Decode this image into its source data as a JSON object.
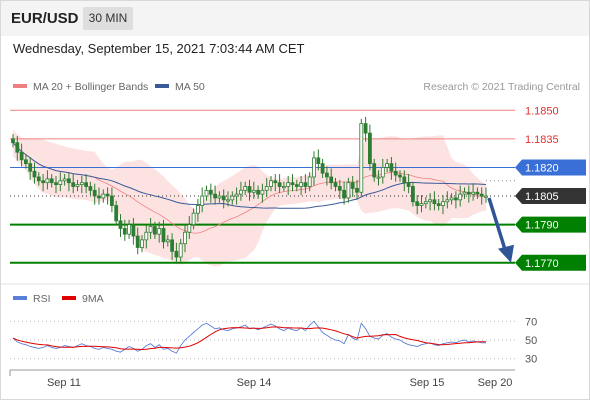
{
  "header": {
    "pair": "EUR/USD",
    "timeframe": "30 MIN",
    "datetime": "Wednesday, September 15, 2021 7:03:44 AM CET"
  },
  "legend": {
    "bollinger": "MA 20 + Bollinger Bands",
    "ma50": "MA 50",
    "rsi": "RSI",
    "ma9": "9MA"
  },
  "copyright": "Research © 2021 Trading Central",
  "colors": {
    "bollinger": "#f08080",
    "band_fill": "#fde2e2",
    "ma50": "#3a5a9a",
    "candle": "#2e7d32",
    "resistance": "#f08080",
    "pivot": "#3a6fd8",
    "current": "#333333",
    "support": "#008000",
    "arrow": "#2f5597",
    "rsi": "#5a7fd8",
    "rsi_ma": "#e00000"
  },
  "chart_data": {
    "type": "candlestick",
    "x_labels": [
      "Sep 11",
      "Sep 14",
      "Sep 15",
      "Sep 20"
    ],
    "y_range": [
      1.1762,
      1.1858
    ],
    "levels": [
      {
        "label": "1.1850",
        "value": 1.185,
        "kind": "resistance"
      },
      {
        "label": "1.1835",
        "value": 1.1835,
        "kind": "resistance"
      },
      {
        "label": "1.1820",
        "value": 1.182,
        "kind": "pivot"
      },
      {
        "label": "1.1805",
        "value": 1.1805,
        "kind": "current"
      },
      {
        "label": "1.1790",
        "value": 1.179,
        "kind": "support"
      },
      {
        "label": "1.1770",
        "value": 1.177,
        "kind": "support"
      }
    ],
    "close": [
      1.1833,
      1.1828,
      1.1824,
      1.1822,
      1.1818,
      1.1815,
      1.1813,
      1.1812,
      1.1814,
      1.1812,
      1.1811,
      1.1813,
      1.1814,
      1.1812,
      1.181,
      1.1811,
      1.1812,
      1.181,
      1.1808,
      1.1805,
      1.1804,
      1.1806,
      1.1805,
      1.18,
      1.1792,
      1.1788,
      1.1785,
      1.179,
      1.1784,
      1.1778,
      1.1782,
      1.1786,
      1.1789,
      1.1785,
      1.1788,
      1.1781,
      1.1782,
      1.1776,
      1.1773,
      1.178,
      1.1786,
      1.179,
      1.1796,
      1.18,
      1.1805,
      1.1808,
      1.1806,
      1.1804,
      1.1805,
      1.1803,
      1.1803,
      1.1805,
      1.1806,
      1.1808,
      1.181,
      1.1807,
      1.1808,
      1.1806,
      1.1808,
      1.181,
      1.1813,
      1.1812,
      1.181,
      1.181,
      1.1812,
      1.1811,
      1.181,
      1.1812,
      1.181,
      1.1815,
      1.1825,
      1.1822,
      1.1817,
      1.1815,
      1.1812,
      1.181,
      1.1808,
      1.1804,
      1.1812,
      1.1809,
      1.1807,
      1.1843,
      1.1838,
      1.1822,
      1.1815,
      1.1815,
      1.182,
      1.1822,
      1.1818,
      1.1816,
      1.1815,
      1.1812,
      1.181,
      1.1802,
      1.18,
      1.1801,
      1.1802,
      1.1803,
      1.1801,
      1.18,
      1.1802,
      1.1803,
      1.1804,
      1.1803,
      1.1806,
      1.1807,
      1.1806,
      1.1807,
      1.1806,
      1.1805,
      1.1805
    ],
    "rsi": [
      52,
      48,
      46,
      45,
      43,
      42,
      41,
      42,
      44,
      42,
      41,
      42,
      44,
      43,
      42,
      44,
      46,
      44,
      43,
      41,
      40,
      42,
      41,
      40,
      38,
      37,
      40,
      43,
      41,
      38,
      40,
      44,
      46,
      42,
      45,
      40,
      41,
      38,
      36,
      44,
      50,
      54,
      58,
      62,
      66,
      68,
      65,
      62,
      63,
      61,
      60,
      62,
      63,
      64,
      66,
      62,
      63,
      61,
      63,
      65,
      67,
      65,
      62,
      60,
      63,
      61,
      60,
      63,
      60,
      66,
      70,
      64,
      58,
      55,
      52,
      50,
      49,
      46,
      56,
      52,
      50,
      68,
      62,
      54,
      52,
      51,
      55,
      57,
      53,
      51,
      50,
      47,
      45,
      44,
      43,
      45,
      46,
      47,
      45,
      44,
      46,
      47,
      48,
      47,
      49,
      50,
      48,
      49,
      48,
      47,
      47
    ],
    "rsi_levels": [
      70,
      50,
      30
    ],
    "rsi_range": [
      20,
      80
    ]
  }
}
